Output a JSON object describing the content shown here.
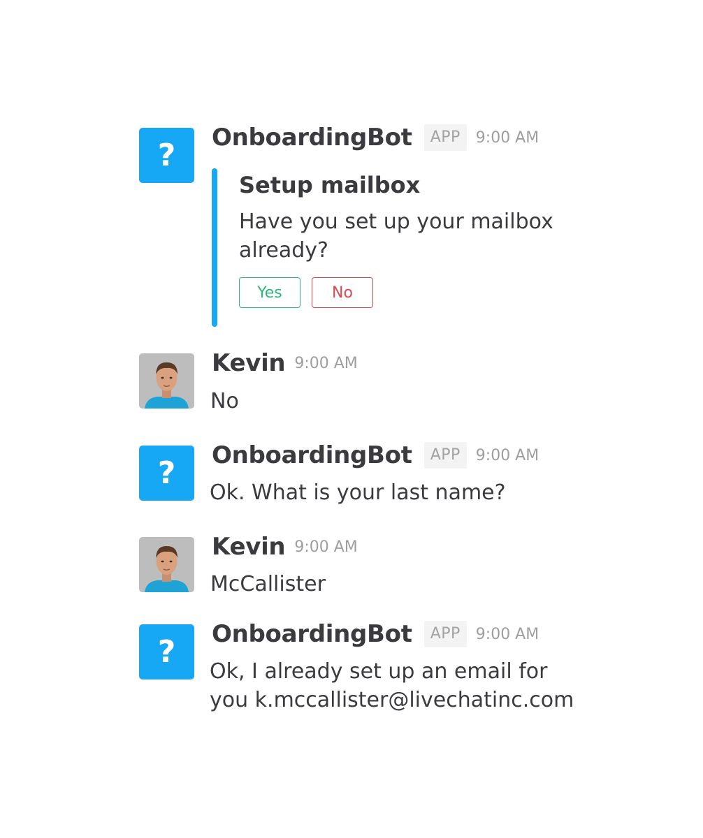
{
  "messages": [
    {
      "author": "OnboardingBot",
      "badge": "APP",
      "time": "9:00 AM",
      "avatar_icon": "question-mark-icon",
      "avatar_glyph": "?",
      "attachment": {
        "title": "Setup mailbox",
        "text_line1": "Have you set up your mailbox",
        "text_line2": "already?",
        "buttons": {
          "yes": "Yes",
          "no": "No"
        },
        "accent_color": "#16a7f5"
      }
    },
    {
      "author": "Kevin",
      "time": "9:00 AM",
      "text": "No"
    },
    {
      "author": "OnboardingBot",
      "badge": "APP",
      "time": "9:00 AM",
      "avatar_glyph": "?",
      "text": "Ok. What is your last name?"
    },
    {
      "author": "Kevin",
      "time": "9:00 AM",
      "text": "McCallister"
    },
    {
      "author": "OnboardingBot",
      "badge": "APP",
      "time": "9:00 AM",
      "avatar_glyph": "?",
      "text_line1": "Ok, I already set up an email for",
      "text_line2": "you k.mccallister@livechatinc.com"
    }
  ],
  "colors": {
    "bot_avatar": "#16a7f5",
    "yes_button": "#2fb67c",
    "no_button": "#e0464e",
    "timestamp": "#9e9e9e",
    "text": "#3b3b3f"
  }
}
